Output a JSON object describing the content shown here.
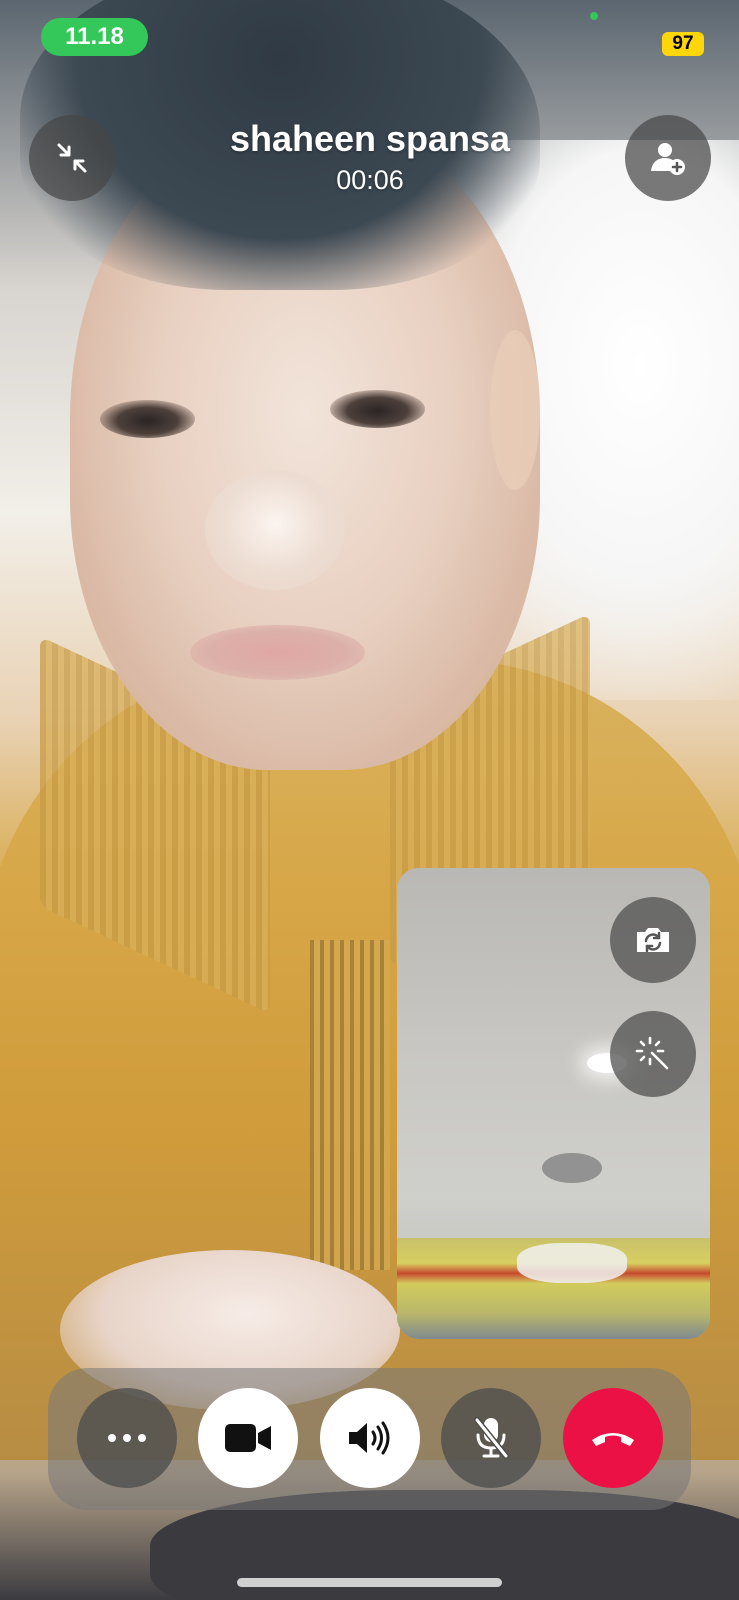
{
  "status_bar": {
    "time": "11.18",
    "battery_level": "97",
    "colors": {
      "time_pill": "#34c759",
      "battery": "#ffd60a"
    }
  },
  "call": {
    "caller_name": "shaheen spansa",
    "duration": "00:06"
  },
  "header_buttons": {
    "minimize_icon": "minimize-arrows-icon",
    "add_person_icon": "add-person-icon"
  },
  "self_view": {
    "flip_camera_icon": "flip-camera-icon",
    "effects_icon": "effects-wand-icon"
  },
  "controls": [
    {
      "id": "more",
      "icon": "more-dots-icon",
      "state": "default"
    },
    {
      "id": "video",
      "icon": "video-camera-icon",
      "state": "on"
    },
    {
      "id": "speaker",
      "icon": "speaker-icon",
      "state": "on"
    },
    {
      "id": "mute",
      "icon": "microphone-muted-icon",
      "state": "off"
    },
    {
      "id": "end",
      "icon": "end-call-icon",
      "color": "#eb1145"
    }
  ]
}
